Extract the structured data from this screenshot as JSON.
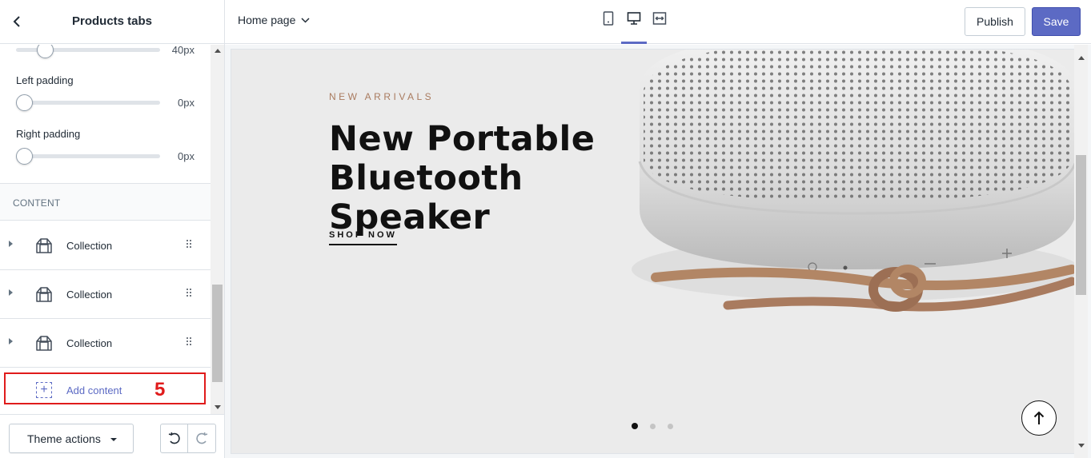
{
  "sidebar": {
    "title": "Products tabs",
    "settings": {
      "top_value": "40px",
      "left_padding": {
        "label": "Left padding",
        "value": "0px"
      },
      "right_padding": {
        "label": "Right padding",
        "value": "0px"
      }
    },
    "content_heading": "CONTENT",
    "blocks": [
      {
        "label": "Collection"
      },
      {
        "label": "Collection"
      },
      {
        "label": "Collection"
      }
    ],
    "add_content_label": "Add content",
    "step_badge": "5",
    "footer": {
      "theme_actions_label": "Theme actions"
    }
  },
  "topbar": {
    "page_selector": "Home page",
    "publish_label": "Publish",
    "save_label": "Save"
  },
  "preview": {
    "eyebrow": "NEW ARRIVALS",
    "title": "New Portable Bluetooth Speaker",
    "cta": "SHOP NOW",
    "slide_count": 3,
    "active_slide": 1
  },
  "colors": {
    "accent": "#5c6ac4",
    "highlight_box": "#e01b1b",
    "eyebrow": "#a97b5f"
  }
}
